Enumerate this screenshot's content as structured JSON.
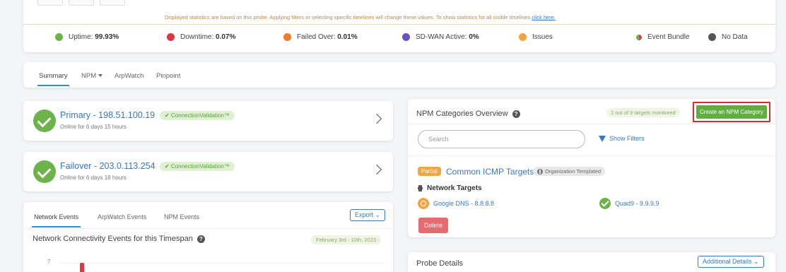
{
  "status": {
    "notice": "Displayed statistics are based on this probe. Applying filters or selecting specific timelines will change these values. To show statistics for all visible timelines",
    "notice_link": "click here.",
    "legend": [
      {
        "label": "Uptime:",
        "value": "99.93%",
        "color": "#6cb34a"
      },
      {
        "label": "Downtime:",
        "value": "0.07%",
        "color": "#d9363e"
      },
      {
        "label": "Failed Over:",
        "value": "0.01%",
        "color": "#f07c2a"
      },
      {
        "label": "SD-WAN Active:",
        "value": "0%",
        "color": "#6a4fc4"
      },
      {
        "label": "Issues",
        "value": "",
        "color": "#f0a544"
      },
      {
        "label": "Event Bundle",
        "value": "",
        "color": "#c0504d"
      },
      {
        "label": "No Data",
        "value": "",
        "color": "#555555"
      }
    ]
  },
  "tabs": {
    "summary": "Summary",
    "npm": "NPM",
    "arpwatch": "ArpWatch",
    "pinpoint": "Pinpoint"
  },
  "primary": {
    "title": "Primary - 198.51.100.19",
    "subtitle": "Online for 6 days 15 hours",
    "badge": "✔ ConnectionValidation™"
  },
  "failover": {
    "title": "Failover - 203.0.113.254",
    "subtitle": "Online for 6 days 18 hours",
    "badge": "✔ ConnectionValidation™"
  },
  "events": {
    "tabs": [
      "Network Events",
      "ArpWatch Events",
      "NPM Events"
    ],
    "export_label": "Export ⌄",
    "heading": "Network Connectivity Events for this Timespan",
    "date_range": "February 3rd - 10th, 2023",
    "y_tick": "7"
  },
  "npm": {
    "title": "NPM Categories Overview",
    "monitored": "2 out of 9 targets monitored",
    "create_label": "Create an NPM Category",
    "search_placeholder": "Search",
    "show_filters": "Show Filters",
    "category": {
      "status": "Partial",
      "name": "Common ICMP Targets",
      "org_badge": "Organization Templated",
      "targets_label": "Network Targets",
      "targets": [
        {
          "name": "Google DNS - 8.8.8.8",
          "state": "warning"
        },
        {
          "name": "Quad9 - 9.9.9.9",
          "state": "ok"
        }
      ],
      "delete_label": "Delete"
    }
  },
  "probe": {
    "title": "Probe Details",
    "additional_label": "Additional Details ⌄"
  }
}
